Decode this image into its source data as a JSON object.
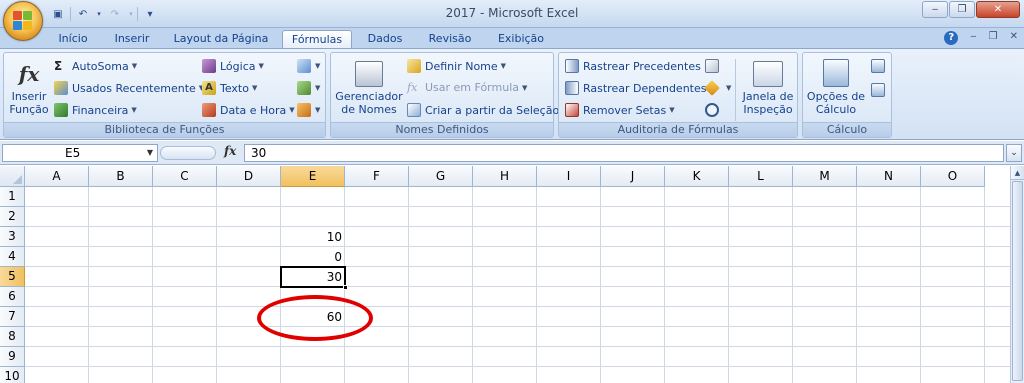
{
  "window": {
    "title": "2017 - Microsoft Excel",
    "minimize": "‒",
    "restore": "❐",
    "close": "✕"
  },
  "qat": {
    "save": "▣",
    "undo": "↶",
    "redo": "↷",
    "customize": "▾"
  },
  "tabs": [
    "Início",
    "Inserir",
    "Layout da Página",
    "Fórmulas",
    "Dados",
    "Revisão",
    "Exibição"
  ],
  "active_tab": "Fórmulas",
  "ribbon_controls": {
    "help": "?",
    "minimize": "‒",
    "restore": "❐",
    "close": "✕"
  },
  "groups": {
    "biblioteca": {
      "label": "Biblioteca de Funções",
      "inserir_funcao": "Inserir\nFunção",
      "autosoma": "AutoSoma",
      "usados": "Usados Recentemente",
      "financeira": "Financeira",
      "logica": "Lógica",
      "texto": "Texto",
      "data_hora": "Data e Hora"
    },
    "nomes": {
      "label": "Nomes Definidos",
      "gerenciador": "Gerenciador\nde Nomes",
      "definir": "Definir Nome",
      "usar": "Usar em Fórmula",
      "criar": "Criar a partir da Seleção"
    },
    "auditoria": {
      "label": "Auditoria de Fórmulas",
      "precedentes": "Rastrear Precedentes",
      "dependentes": "Rastrear Dependentes",
      "remover": "Remover Setas",
      "janela": "Janela de\nInspeção"
    },
    "calculo": {
      "label": "Cálculo",
      "opcoes": "Opções de\nCálculo"
    }
  },
  "formula_bar": {
    "name_box": "E5",
    "fx": "fx",
    "value": "30"
  },
  "columns": [
    "A",
    "B",
    "C",
    "D",
    "E",
    "F",
    "G",
    "H",
    "I",
    "J",
    "K",
    "L",
    "M",
    "N",
    "O"
  ],
  "rows": [
    "1",
    "2",
    "3",
    "4",
    "5",
    "6",
    "7",
    "8",
    "9",
    "10"
  ],
  "cells": {
    "E3": "10",
    "E4": "0",
    "E5": "30",
    "E7": "60"
  },
  "selected": {
    "col": "E",
    "row": "5"
  },
  "accent": {
    "annotation": "#e00000",
    "selection_header": "#f1c15f"
  }
}
